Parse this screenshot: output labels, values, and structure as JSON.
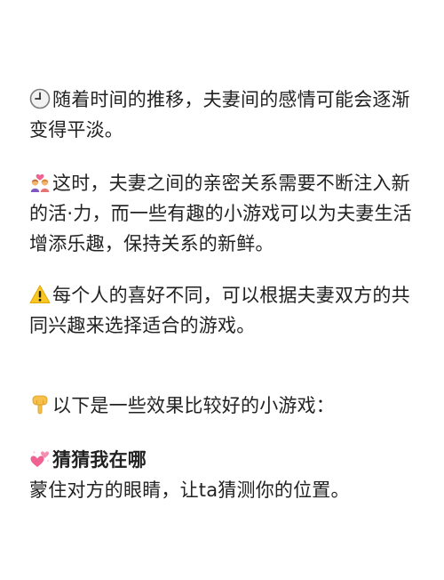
{
  "paragraphs": {
    "p1": {
      "icon": "clock-icon",
      "text": "随着时间的推移，夫妻间的感情可能会逐渐变得平淡。"
    },
    "p2": {
      "icon": "couple-heart-icon",
      "text": "这时，夫妻之间的亲密关系需要不断注入新的活·力，而一些有趣的小游戏可以为夫妻生活增添乐趣，保持关系的新鲜。"
    },
    "p3": {
      "icon": "warning-icon",
      "text": "每个人的喜好不同，可以根据夫妻双方的共同兴趣来选择适合的游戏。"
    },
    "p4": {
      "icon": "pointing-down-icon",
      "text": "以下是一些效果比较好的小游戏："
    },
    "p5": {
      "icon": "two-hearts-icon",
      "title": "猜猜我在哪",
      "text": "蒙住对方的眼睛，让ta猜测你的位置。"
    }
  },
  "colors": {
    "text": "#222222",
    "background": "#ffffff",
    "heart_pink": "#f06292",
    "warning_yellow": "#f9c623",
    "hand_yellow": "#f6c04b"
  }
}
